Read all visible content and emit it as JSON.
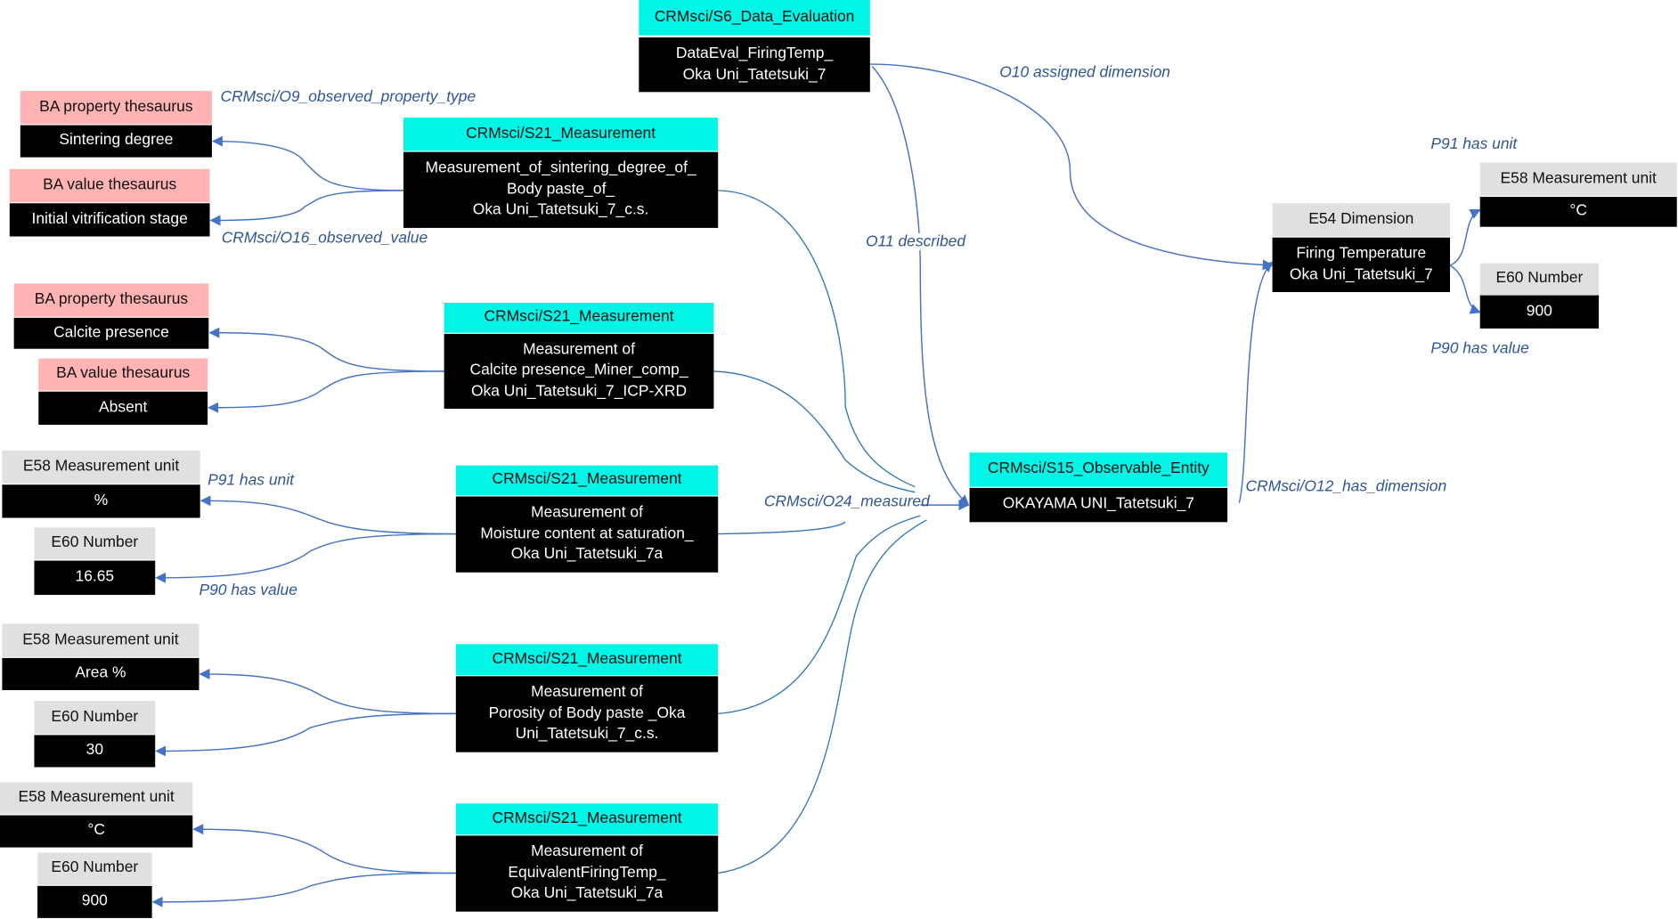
{
  "colors": {
    "class_header": "#00f5e6",
    "thesaurus_header": "#ffb3b3",
    "entity_header": "#e0e0e0",
    "instance": "#000000",
    "edge": "#4472c4",
    "edge_label": "#2f5597"
  },
  "data_evaluation": {
    "class": "CRMsci/S6_Data_Evaluation",
    "lines": [
      "DataEval_FiringTemp_",
      "Oka Uni_Tatetsuki_7"
    ]
  },
  "observable_entity": {
    "class": "CRMsci/S15_Observable_Entity",
    "lines": [
      "OKAYAMA UNI_Tatetsuki_7"
    ]
  },
  "dimension": {
    "class": "E54 Dimension",
    "lines": [
      "Firing Temperature",
      "Oka Uni_Tatetsuki_7"
    ],
    "unit_class": "E58 Measurement unit",
    "unit": "°C",
    "number_class": "E60 Number",
    "number": "900"
  },
  "measurements": [
    {
      "class": "CRMsci/S21_Measurement",
      "lines": [
        "Measurement_of_sintering_degree_of_",
        "Body paste_of_",
        "Oka Uni_Tatetsuki_7_c.s."
      ],
      "a_class": "BA property thesaurus",
      "a_value": "Sintering degree",
      "b_class": "BA value thesaurus",
      "b_value": "Initial vitrification stage"
    },
    {
      "class": "CRMsci/S21_Measurement",
      "lines": [
        "Measurement of",
        "Calcite presence_Miner_comp_",
        "Oka Uni_Tatetsuki_7_ICP-XRD"
      ],
      "a_class": "BA property thesaurus",
      "a_value": "Calcite presence",
      "b_class": "BA value thesaurus",
      "b_value": "Absent"
    },
    {
      "class": "CRMsci/S21_Measurement",
      "lines": [
        "Measurement of",
        "Moisture content at saturation_",
        "Oka Uni_Tatetsuki_7a"
      ],
      "a_class": "E58 Measurement unit",
      "a_value": "%",
      "b_class": "E60 Number",
      "b_value": "16.65"
    },
    {
      "class": "CRMsci/S21_Measurement",
      "lines": [
        "Measurement of",
        "Porosity of Body paste _Oka",
        "Uni_Tatetsuki_7_c.s."
      ],
      "a_class": "E58 Measurement unit",
      "a_value": "Area %",
      "b_class": "E60 Number",
      "b_value": "30"
    },
    {
      "class": "CRMsci/S21_Measurement",
      "lines": [
        "Measurement of",
        "EquivalentFiringTemp_",
        "Oka Uni_Tatetsuki_7a"
      ],
      "a_class": "E58 Measurement unit",
      "a_value": "°C",
      "b_class": "E60 Number",
      "b_value": "900"
    }
  ],
  "edge_labels": {
    "o9": "CRMsci/O9_observed_property_type",
    "o16": "CRMsci/O16_observed_value",
    "p91_left": "P91 has unit",
    "p90_left": "P90 has value",
    "o24": "CRMsci/O24_measured",
    "o10": "O10 assigned dimension",
    "o11": "O11 described",
    "o12": "CRMsci/O12_has_dimension",
    "p91_right": "P91 has unit",
    "p90_right": "P90 has value"
  }
}
